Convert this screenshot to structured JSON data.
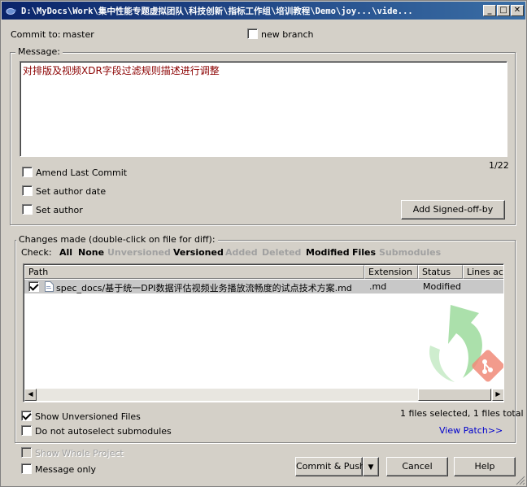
{
  "window": {
    "title": "D:\\MyDocs\\Work\\集中性能专题虚拟团队\\科技创新\\指标工作组\\培训教程\\Demo\\joy...\\vide...",
    "minimize": "_",
    "maximize": "□",
    "close": "✕"
  },
  "commit": {
    "commit_to_label": "Commit to:",
    "branch": "master",
    "new_branch_label": "new branch"
  },
  "message": {
    "legend": "Message:",
    "text": "对排版及视频XDR字段过滤规则描述进行调整",
    "counter": "1/22"
  },
  "options": {
    "amend": "Amend Last Commit",
    "set_author_date": "Set author date",
    "set_author": "Set author",
    "signed_off_button": "Add Signed-off-by"
  },
  "changes": {
    "legend": "Changes made (double-click on file for diff):",
    "check_label": "Check:",
    "filters": [
      {
        "label": "All",
        "enabled": true
      },
      {
        "label": "None",
        "enabled": true
      },
      {
        "label": "Unversioned",
        "enabled": false
      },
      {
        "label": "Versioned",
        "enabled": true
      },
      {
        "label": "Added",
        "enabled": false
      },
      {
        "label": "Deleted",
        "enabled": false
      },
      {
        "label": "Modified",
        "enabled": true
      },
      {
        "label": "Files",
        "enabled": true
      },
      {
        "label": "Submodules",
        "enabled": false
      }
    ],
    "columns": [
      "Path",
      "Extension",
      "Status",
      "Lines ac"
    ],
    "files": [
      {
        "checked": true,
        "path": "spec_docs/基于统一DPI数据评估视频业务播放流畅度的试点技术方案.md",
        "extension": ".md",
        "status": "Modified"
      }
    ],
    "show_unversioned": "Show Unversioned Files",
    "no_autoselect": "Do not autoselect submodules",
    "selection_summary": "1 files selected, 1 files total",
    "view_patch": "View Patch>>"
  },
  "bottom": {
    "show_whole_project": "Show Whole Project",
    "message_only": "Message only",
    "commit_push": "Commit & Push",
    "cancel": "Cancel",
    "help": "Help"
  },
  "colors": {
    "titlebar_start": "#0a246a",
    "titlebar_end": "#3a6ea5",
    "message_text": "#8b0000",
    "link": "#0000cc",
    "watermark_green": "#4caf50",
    "watermark_red": "#e05040"
  }
}
